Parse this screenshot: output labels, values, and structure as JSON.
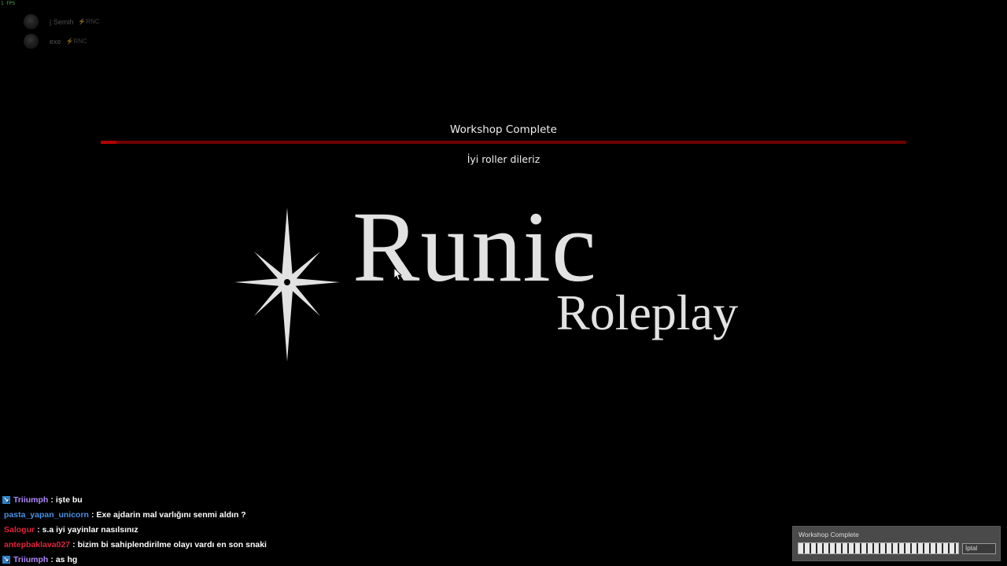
{
  "overlay": {
    "fps": "1 FPS"
  },
  "voice": [
    {
      "name": "| Semih",
      "tag": "⚡RNC"
    },
    {
      "name": "exe",
      "tag": "⚡RNC"
    }
  ],
  "loading": {
    "title": "Workshop Complete",
    "subtitle": "İyi roller dileriz",
    "progress": 0.02,
    "bar_color": "#b40000",
    "track_color": "#6e0000"
  },
  "logo": {
    "name": "Runic",
    "subname": "Roleplay",
    "icon": "compass-star-icon"
  },
  "chat": [
    {
      "badge": true,
      "name": "Triiumph",
      "color": "#b388ff",
      "message": "işte bu"
    },
    {
      "badge": false,
      "name": "pasta_yapan_unicorn",
      "color": "#4a90e2",
      "message": "Exe ajdarin mal varlığını senmi aldın ?"
    },
    {
      "badge": false,
      "name": "Salogur",
      "color": "#e0243a",
      "message": "s.a iyi yayinlar nasılsınız"
    },
    {
      "badge": false,
      "name": "antepbaklava027",
      "color": "#e0243a",
      "message": "bizim bi sahiplendirilme olayı vardı en son snaki"
    },
    {
      "badge": true,
      "name": "Triiumph",
      "color": "#b388ff",
      "message": "as hg"
    }
  ],
  "download": {
    "title": "Workshop Complete",
    "progress": 1.0,
    "cancel_label": "İptal"
  }
}
